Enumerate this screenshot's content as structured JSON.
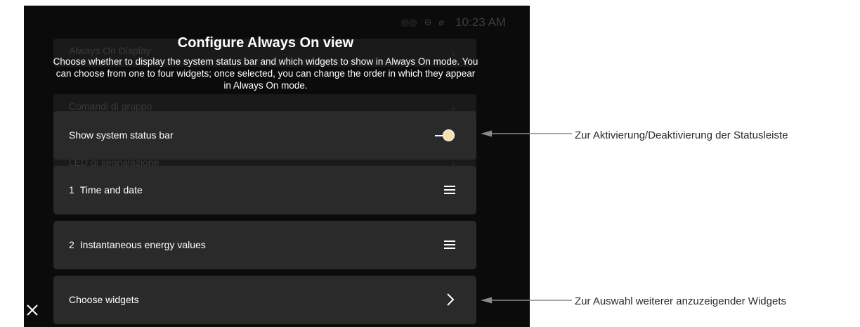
{
  "status_bar": {
    "icons": [
      "voicemail-icon",
      "do-not-disturb-icon",
      "no-network-icon"
    ],
    "time": "10:23 AM"
  },
  "background_menu": [
    {
      "label": "Always On Display"
    },
    {
      "label": "Comandi di gruppo"
    },
    {
      "label": "LED di segnalazione"
    }
  ],
  "dialog": {
    "title": "Configure Always On view",
    "description": "Choose whether to display the system status bar and which widgets to show in Always On mode. You can choose from one to four widgets; once selected, you can change the order in which they appear in Always On mode.",
    "status_bar_row": {
      "label": "Show system status bar",
      "toggle_on": true
    },
    "widgets": [
      {
        "number": "1",
        "label": "Time and date"
      },
      {
        "number": "2",
        "label": "Instantaneous energy values"
      }
    ],
    "choose_row": {
      "label": "Choose widgets"
    },
    "close_icon": "close-icon"
  },
  "annotations": {
    "status_bar_toggle": "Zur Aktivierung/Deaktivierung der Statusleiste",
    "choose_widgets": "Zur Auswahl weiterer anzuzeigender Widgets"
  },
  "colors": {
    "screen_bg": "#0b0b0b",
    "card_bg": "#2a2a2a",
    "toggle_thumb": "#f5dfae",
    "annotation_line": "#8a8a8a"
  }
}
